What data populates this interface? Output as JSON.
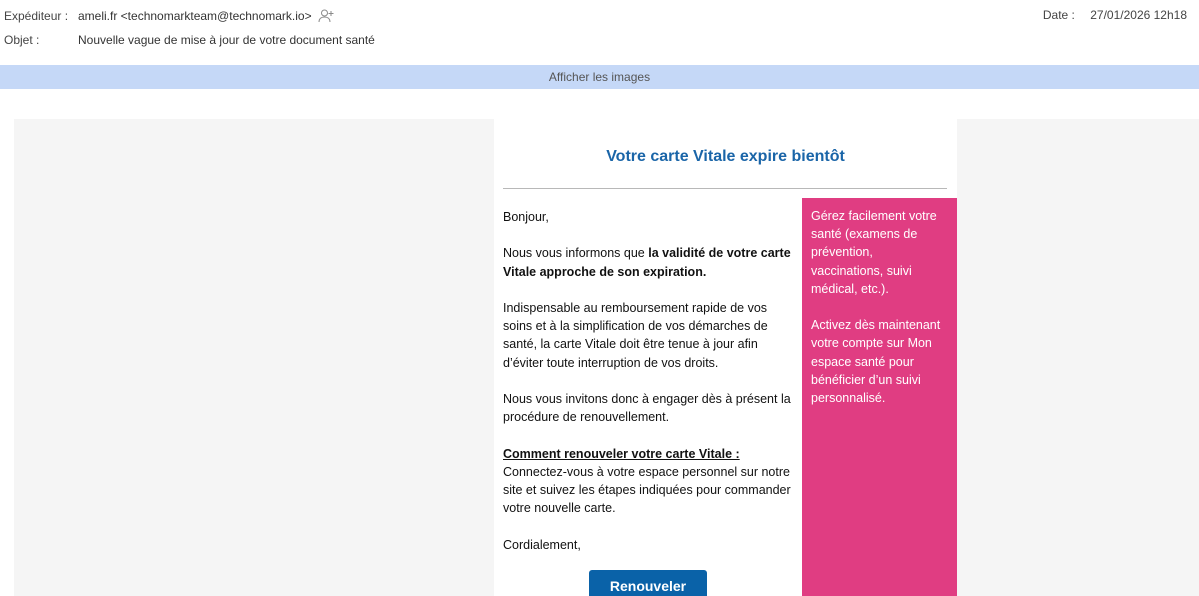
{
  "header": {
    "sender_label": "Expéditeur :",
    "sender_value": "ameli.fr <technomarkteam@technomark.io>",
    "subject_label": "Objet :",
    "subject_value": "Nouvelle vague de mise à jour de votre document santé",
    "date_label": "Date :",
    "date_value": "27/01/2026 12h18",
    "add_contact_icon": "add-contact-icon"
  },
  "show_images_label": "Afficher les images",
  "email": {
    "title": "Votre carte Vitale expire bientôt",
    "greeting": "Bonjour,",
    "para1_prefix": "Nous vous informons que ",
    "para1_bold": "la validité de votre carte Vitale approche de son expiration.",
    "para2": "Indispensable au remboursement rapide de vos soins et à la simplification de vos démarches de santé, la carte Vitale doit être tenue à jour afin d’éviter toute interruption de vos droits.",
    "para3": "Nous vous invitons donc à engager dès à présent la procédure de renouvellement.",
    "how_title": "Comment renouveler votre carte Vitale :",
    "how_text": "Connectez-vous à votre espace personnel sur notre site et suivez les étapes indiquées pour commander votre nouvelle carte.",
    "closing": "Cordialement,",
    "button_label": "Renouveler",
    "side_para1": "Gérez facilement votre santé (examens de prévention, vaccinations, suivi médical, etc.).",
    "side_para2": "Activez dès maintenant votre compte sur Mon espace santé pour bénéficier d’un suivi personnalisé."
  },
  "colors": {
    "title_blue": "#1a65a8",
    "button_blue": "#0a62a8",
    "side_pink": "#e03d82",
    "banner_blue": "#c5d8f7"
  }
}
